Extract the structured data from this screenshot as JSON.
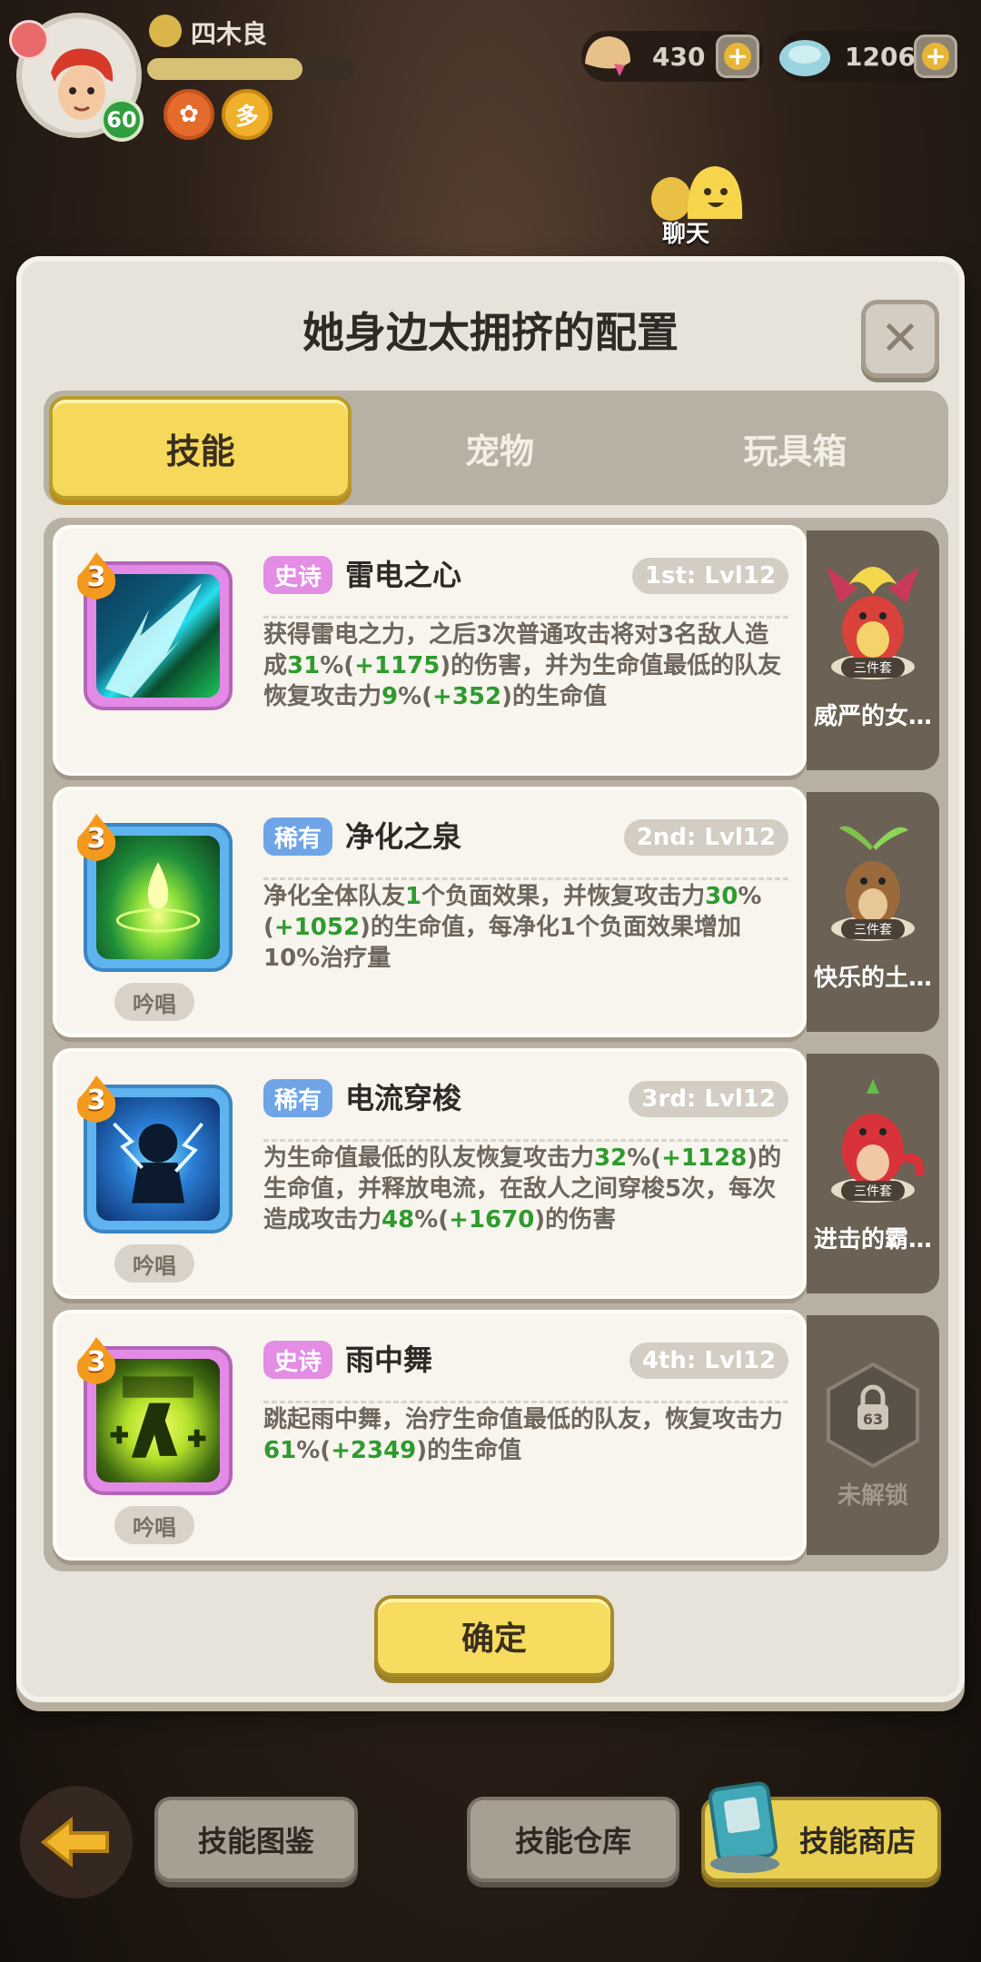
{
  "player": {
    "name": "四木良",
    "level": "60",
    "exp_fraction": 0.75
  },
  "currencies": [
    {
      "name": "gold-shell",
      "amount": "430"
    },
    {
      "name": "diamond-shell",
      "amount": "1206"
    }
  ],
  "chat": {
    "label": "聊天"
  },
  "dialog": {
    "title": "她身边太拥挤的配置",
    "close_icon": "close-icon",
    "tabs": [
      "技能",
      "宠物",
      "玩具箱"
    ],
    "active_tab": 0,
    "confirm_label": "确定"
  },
  "skills": [
    {
      "level": "3",
      "rarity": "史诗",
      "rarity_type": "epic",
      "name": "雷电之心",
      "slot": "1st: Lvl12",
      "desc_parts": [
        "获得雷电之力，之后3次普通攻击将对3名敌人造成",
        "31",
        "%(",
        "+1175",
        ")的伤害，并为生命值最低的队友恢复攻击力",
        "9",
        "%(",
        "+352",
        ")的生命值"
      ],
      "chant": "",
      "pet": {
        "name": "威严的女…",
        "set_label": "三件套"
      }
    },
    {
      "level": "3",
      "rarity": "稀有",
      "rarity_type": "rare",
      "name": "净化之泉",
      "slot": "2nd: Lvl12",
      "desc_parts": [
        "净化全体队友",
        "1",
        "个负面效果，并恢复攻击力",
        "30",
        "%(",
        "+1052",
        ")的生命值，每净化1个负面效果增加10%治疗量",
        "",
        "",
        "",
        ""
      ],
      "chant": "吟唱",
      "pet": {
        "name": "快乐的土…",
        "set_label": "三件套"
      }
    },
    {
      "level": "3",
      "rarity": "稀有",
      "rarity_type": "rare",
      "name": "电流穿梭",
      "slot": "3rd: Lvl12",
      "desc_parts": [
        "为生命值最低的队友恢复攻击力",
        "32",
        "%(",
        "+1128",
        ")的生命值，并释放电流，在敌人之间穿梭5次，每次造成攻击力",
        "48",
        "%(",
        "+1670",
        ")的伤害"
      ],
      "chant": "吟唱",
      "pet": {
        "name": "进击的霸…",
        "set_label": "三件套"
      }
    },
    {
      "level": "3",
      "rarity": "史诗",
      "rarity_type": "epic",
      "name": "雨中舞",
      "slot": "4th: Lvl12",
      "desc_parts": [
        "跳起雨中舞，治疗生命值最低的队友，恢复攻击力",
        "61",
        "%(",
        "+2349",
        ")的生命值",
        "",
        "",
        "",
        ""
      ],
      "chant": "吟唱",
      "locked": {
        "level": "63",
        "label": "未解锁"
      }
    }
  ],
  "bottom_bar": {
    "back_icon": "back-arrow-icon",
    "buttons": [
      "技能图鉴",
      "技能仓库",
      "技能商店"
    ]
  },
  "colors": {
    "accent_yellow": "#f7dc5f",
    "epic": "#e38de4",
    "rare": "#6fa5e7",
    "value_green": "#2e9b2e"
  }
}
